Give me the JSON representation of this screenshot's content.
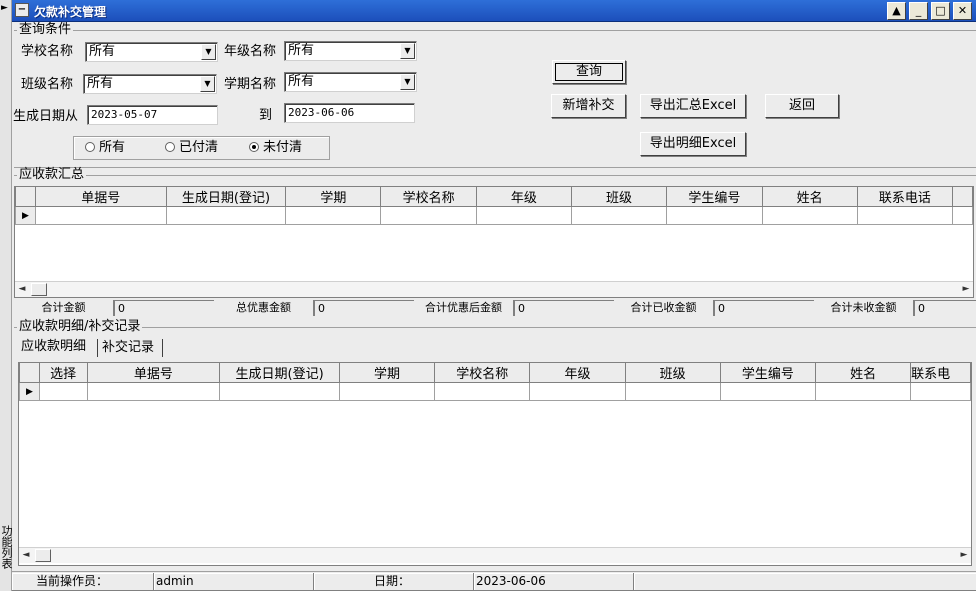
{
  "window": {
    "title": "欠款补交管理",
    "left_strip_label": "功能列表"
  },
  "query": {
    "group_title": "查询条件",
    "school_label": "学校名称",
    "school_value": "所有",
    "grade_label": "年级名称",
    "grade_value": "所有",
    "class_label": "班级名称",
    "class_value": "所有",
    "term_label": "学期名称",
    "term_value": "所有",
    "date_from_label": "生成日期从",
    "date_from": "2023-05-07",
    "date_to_label": "到",
    "date_to": "2023-06-06",
    "radios": [
      {
        "label": "所有",
        "checked": false
      },
      {
        "label": "已付清",
        "checked": false
      },
      {
        "label": "未付清",
        "checked": true
      }
    ]
  },
  "buttons": {
    "query": "查询",
    "add_payment": "新增补交",
    "export_summary": "导出汇总Excel",
    "back": "返回",
    "export_detail": "导出明细Excel"
  },
  "summary": {
    "group_title": "应收款汇总",
    "columns": [
      "单据号",
      "生成日期(登记)",
      "学期",
      "学校名称",
      "年级",
      "班级",
      "学生编号",
      "姓名",
      "联系电话"
    ],
    "totals": [
      {
        "label": "合计金额",
        "value": "0"
      },
      {
        "label": "总优惠金额",
        "value": "0"
      },
      {
        "label": "合计优惠后金额",
        "value": "0"
      },
      {
        "label": "合计已收金额",
        "value": "0"
      },
      {
        "label": "合计未收金额",
        "value": "0"
      }
    ]
  },
  "detail": {
    "group_title": "应收款明细/补交记录",
    "tabs": [
      "应收款明细",
      "补交记录"
    ],
    "columns": [
      "选择",
      "单据号",
      "生成日期(登记)",
      "学期",
      "学校名称",
      "年级",
      "班级",
      "学生编号",
      "姓名",
      "联系电"
    ]
  },
  "statusbar": {
    "operator_label": "当前操作员：",
    "operator": "admin",
    "date_label": "日期：",
    "date": "2023-06-06"
  }
}
